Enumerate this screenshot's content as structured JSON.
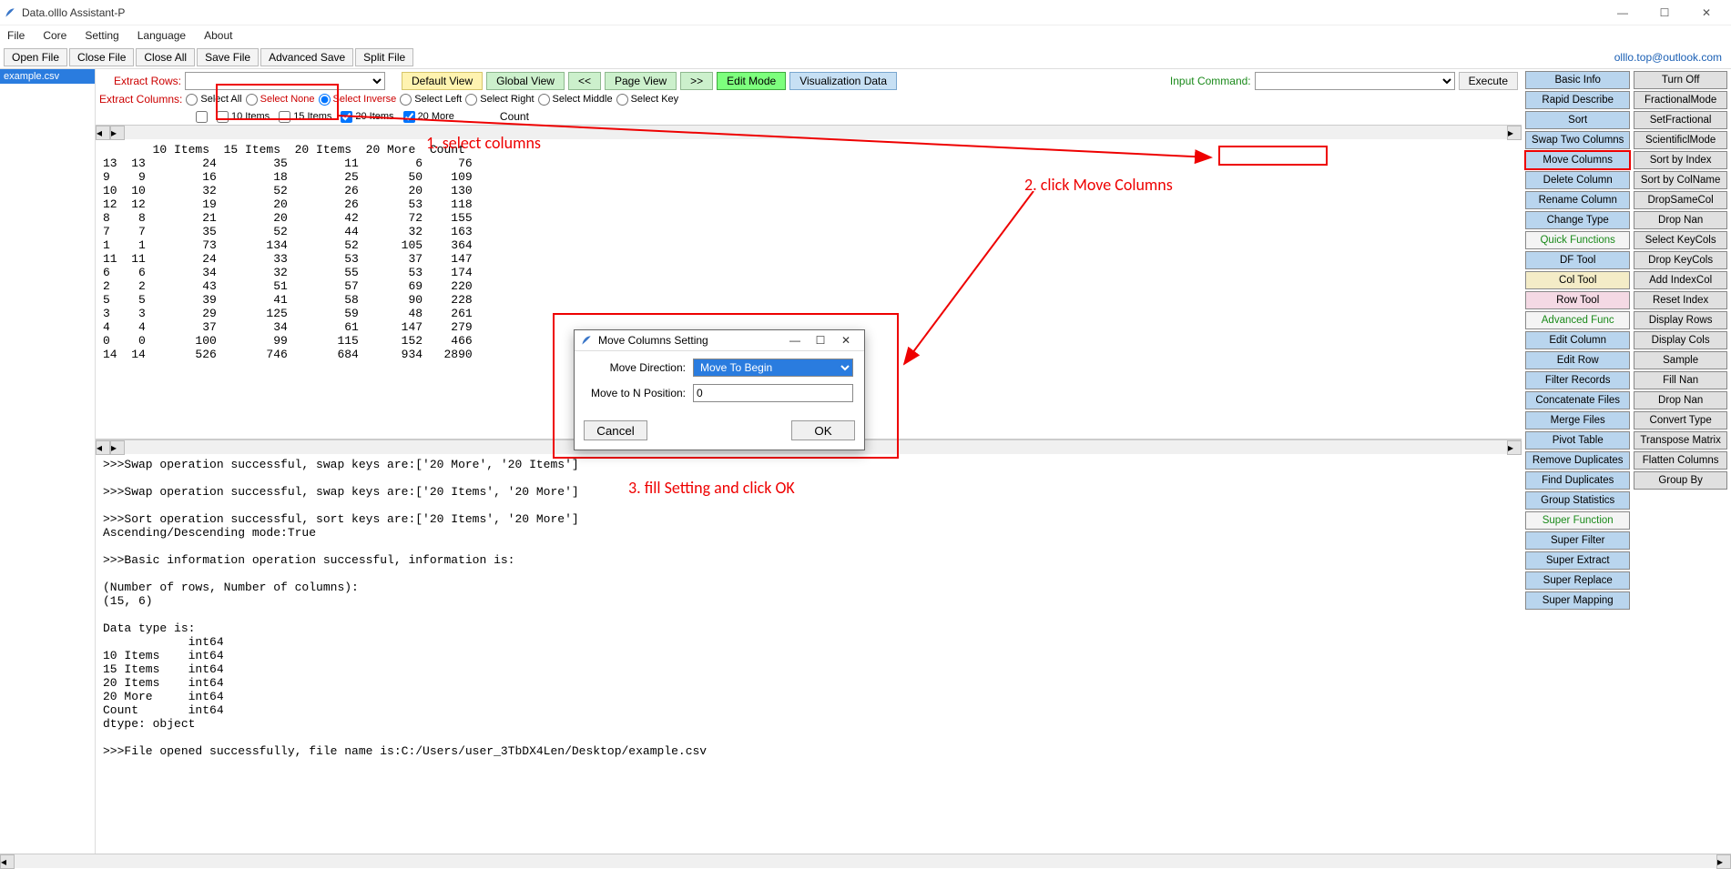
{
  "window": {
    "title": "Data.olllo Assistant-P"
  },
  "menu": {
    "file": "File",
    "core": "Core",
    "setting": "Setting",
    "language": "Language",
    "about": "About"
  },
  "toolbar": {
    "open": "Open File",
    "close": "Close File",
    "closeall": "Close All",
    "save": "Save File",
    "advsave": "Advanced Save",
    "split": "Split File",
    "email": "olllo.top@outlook.com"
  },
  "files": {
    "tab0": "example.csv"
  },
  "rows": {
    "extract_rows": "Extract Rows:",
    "default": "Default View",
    "global": "Global View",
    "prev": "<<",
    "page": "Page View",
    "next": ">>",
    "edit": "Edit Mode",
    "viz": "Visualization Data",
    "input_cmd": "Input Command:",
    "execute": "Execute"
  },
  "cols": {
    "extract_cols": "Extract Columns:",
    "sel_all": "Select All",
    "sel_none": "Select None",
    "sel_inv": "Select Inverse",
    "sel_left": "Select Left",
    "sel_right": "Select Right",
    "sel_mid": "Select Middle",
    "sel_key": "Select Key"
  },
  "chk": {
    "c10": "10 Items",
    "c15": "15 Items",
    "c20": "20 Items",
    "c20m": "20 More",
    "count": "Count"
  },
  "annotations": {
    "a1": "1. select columns",
    "a2": "2. click Move Columns",
    "a3": "3. fill Setting and click OK"
  },
  "table_text": "       10 Items  15 Items  20 Items  20 More  Count\n13  13        24        35        11        6     76\n9    9        16        18        25       50    109\n10  10        32        52        26       20    130\n12  12        19        20        26       53    118\n8    8        21        20        42       72    155\n7    7        35        52        44       32    163\n1    1        73       134        52      105    364\n11  11        24        33        53       37    147\n6    6        34        32        55       53    174\n2    2        43        51        57       69    220\n5    5        39        41        58       90    228\n3    3        29       125        59       48    261\n4    4        37        34        61      147    279\n0    0       100        99       115      152    466\n14  14       526       746       684      934   2890",
  "log_text": ">>>Swap operation successful, swap keys are:['20 More', '20 Items']\n\n>>>Swap operation successful, swap keys are:['20 Items', '20 More']\n\n>>>Sort operation successful, sort keys are:['20 Items', '20 More']\nAscending/Descending mode:True\n\n>>>Basic information operation successful, information is:\n\n(Number of rows, Number of columns):\n(15, 6)\n\nData type is:\n            int64\n10 Items    int64\n15 Items    int64\n20 Items    int64\n20 More     int64\nCount       int64\ndtype: object\n\n>>>File opened successfully, file name is:C:/Users/user_3TbDX4Len/Desktop/example.csv",
  "panel1": {
    "basic": "Basic Info",
    "rapid": "Rapid Describe",
    "sort": "Sort",
    "swap": "Swap Two Columns",
    "move": "Move Columns",
    "del": "Delete Column",
    "rename": "Rename Column",
    "ctype": "Change Type",
    "quick": "Quick Functions",
    "dftool": "DF Tool",
    "coltool": "Col Tool",
    "rowtool": "Row Tool",
    "adv": "Advanced Func",
    "editcol": "Edit Column",
    "editrow": "Edit Row",
    "filter": "Filter Records",
    "concat": "Concatenate Files",
    "merge": "Merge Files",
    "pivot": "Pivot Table",
    "rmdup": "Remove Duplicates",
    "finddup": "Find Duplicates",
    "gstat": "Group Statistics",
    "superfn": "Super Function",
    "sfilter": "Super Filter",
    "sextract": "Super Extract",
    "sreplace": "Super Replace",
    "smapping": "Super Mapping"
  },
  "panel2": {
    "turnoff": "Turn Off",
    "frac": "FractionalMode",
    "setfrac": "SetFractional",
    "sci": "ScientificlMode",
    "sortidx": "Sort by Index",
    "sortcol": "Sort by ColName",
    "dropsame": "DropSameCol",
    "dropnan": "Drop Nan",
    "selkey": "Select KeyCols",
    "dropkey": "Drop KeyCols",
    "addidx": "Add IndexCol",
    "resetidx": "Reset Index",
    "disprows": "Display Rows",
    "dispcols": "Display Cols",
    "sample": "Sample",
    "fillnan": "Fill Nan",
    "dropnan2": "Drop Nan",
    "convtype": "Convert Type",
    "transpose": "Transpose Matrix",
    "flatten": "Flatten Columns",
    "groupby": "Group By"
  },
  "dialog": {
    "title": "Move Columns Setting",
    "dir_lbl": "Move Direction:",
    "dir_val": "Move To Begin",
    "pos_lbl": "Move to N Position:",
    "pos_val": "0",
    "cancel": "Cancel",
    "ok": "OK"
  }
}
